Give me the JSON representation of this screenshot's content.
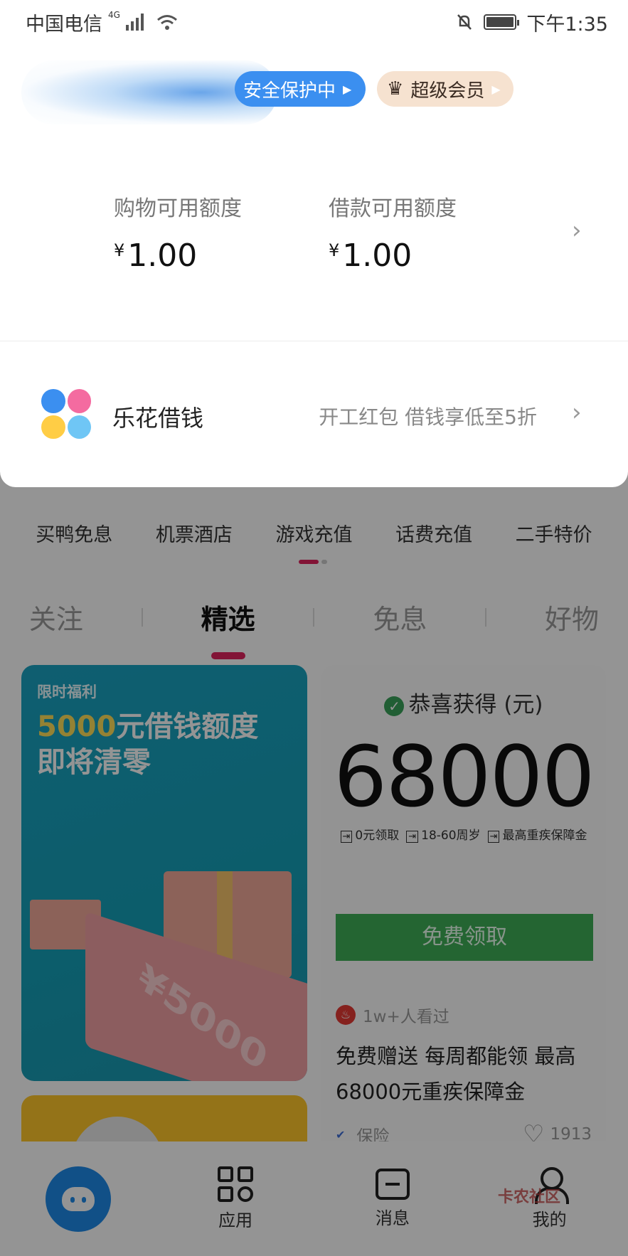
{
  "status_bar": {
    "carrier": "中国电信",
    "network": "4G",
    "time": "下午1:35"
  },
  "header": {
    "security_label": "安全保护中",
    "vip_label": "超级会员"
  },
  "credits": [
    {
      "label": "购物可用额度",
      "currency": "¥",
      "value": "1.00"
    },
    {
      "label": "借款可用额度",
      "currency": "¥",
      "value": "1.00"
    }
  ],
  "lehua": {
    "name": "乐花借钱",
    "promo": "开工红包 借钱享低至5折",
    "logo_colors": [
      "#3b8ff0",
      "#f46ba0",
      "#ffcd45",
      "#6fc6f5"
    ]
  },
  "quick_menu": [
    "买鸭免息",
    "机票酒店",
    "游戏充值",
    "话费充值",
    "二手特价"
  ],
  "feed_tabs": [
    {
      "label": "关注",
      "active": false
    },
    {
      "label": "精选",
      "active": true
    },
    {
      "label": "免息",
      "active": false
    },
    {
      "label": "好物",
      "active": false
    }
  ],
  "promo_card": {
    "tag": "限时福利",
    "title_highlight": "5000",
    "title_rest": "元借钱额度",
    "title_line2": "即将清零",
    "money_text": "¥5000"
  },
  "insurance_card": {
    "heading": "恭喜获得 (元)",
    "amount": "68000",
    "tags": [
      "0元领取",
      "18-60周岁",
      "最高重疾保障金"
    ],
    "button": "免费领取",
    "views": "1w+人看过",
    "description": "免费赠送 每周都能领 最高68000元重疾保障金",
    "category": "保险",
    "likes": "1913"
  },
  "bottom_nav": [
    {
      "label": ""
    },
    {
      "label": "应用"
    },
    {
      "label": "消息"
    },
    {
      "label": "我的"
    }
  ],
  "watermark": "卡农社区",
  "colors": {
    "accent_blue": "#3b8ff0",
    "tab_indicator": "#e0245e",
    "green_button": "#3fae56"
  }
}
